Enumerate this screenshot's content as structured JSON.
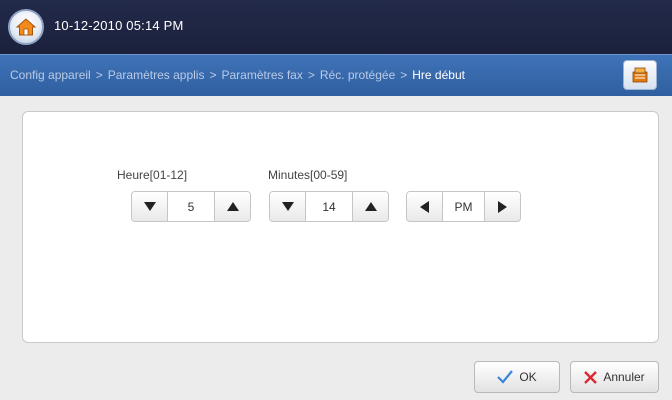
{
  "header": {
    "datetime": "10-12-2010 05:14 PM",
    "home_icon": "home-icon"
  },
  "breadcrumb": {
    "items": [
      "Config appareil",
      "Paramètres applis",
      "Paramètres fax",
      "Réc. protégée"
    ],
    "current": "Hre début",
    "separator": ">",
    "menu_icon": "job-status-icon"
  },
  "time_setting": {
    "hour": {
      "label": "Heure[01-12]",
      "value": "5"
    },
    "minutes": {
      "label": "Minutes[00-59]",
      "value": "14"
    },
    "ampm": {
      "value": "PM"
    }
  },
  "actions": {
    "ok_label": "OK",
    "cancel_label": "Annuler"
  },
  "colors": {
    "topbar": "#1f2542",
    "breadcrumb_bar": "#3a6db0",
    "ok_check": "#3d86d6",
    "cancel_x": "#d9282f"
  }
}
